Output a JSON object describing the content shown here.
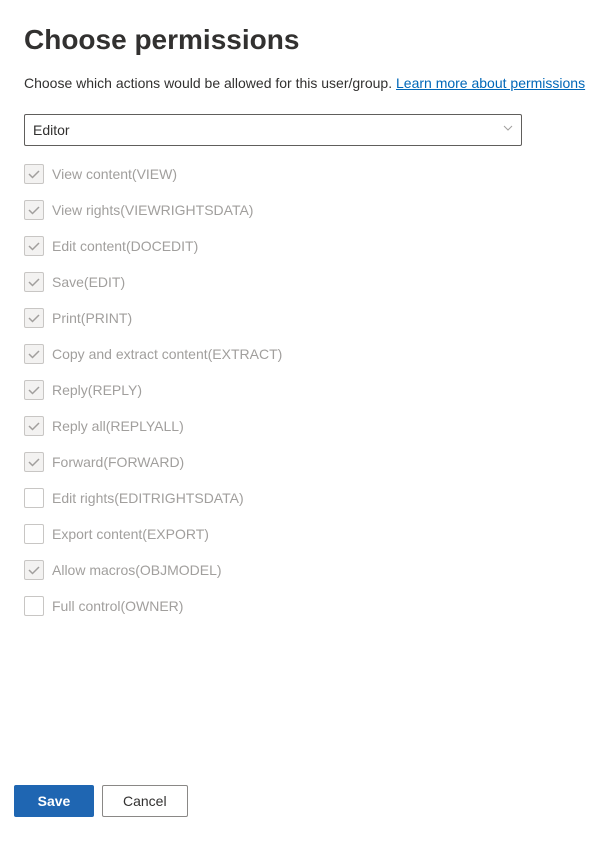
{
  "title": "Choose permissions",
  "description": "Choose which actions would be allowed for this user/group.",
  "learn_more": "Learn more about permissions",
  "select": {
    "value": "Editor"
  },
  "permissions": [
    {
      "label": "View content(VIEW)",
      "checked": true
    },
    {
      "label": "View rights(VIEWRIGHTSDATA)",
      "checked": true
    },
    {
      "label": "Edit content(DOCEDIT)",
      "checked": true
    },
    {
      "label": "Save(EDIT)",
      "checked": true
    },
    {
      "label": "Print(PRINT)",
      "checked": true
    },
    {
      "label": "Copy and extract content(EXTRACT)",
      "checked": true
    },
    {
      "label": "Reply(REPLY)",
      "checked": true
    },
    {
      "label": "Reply all(REPLYALL)",
      "checked": true
    },
    {
      "label": "Forward(FORWARD)",
      "checked": true
    },
    {
      "label": "Edit rights(EDITRIGHTSDATA)",
      "checked": false
    },
    {
      "label": "Export content(EXPORT)",
      "checked": false
    },
    {
      "label": "Allow macros(OBJMODEL)",
      "checked": true
    },
    {
      "label": "Full control(OWNER)",
      "checked": false
    }
  ],
  "buttons": {
    "save": "Save",
    "cancel": "Cancel"
  }
}
